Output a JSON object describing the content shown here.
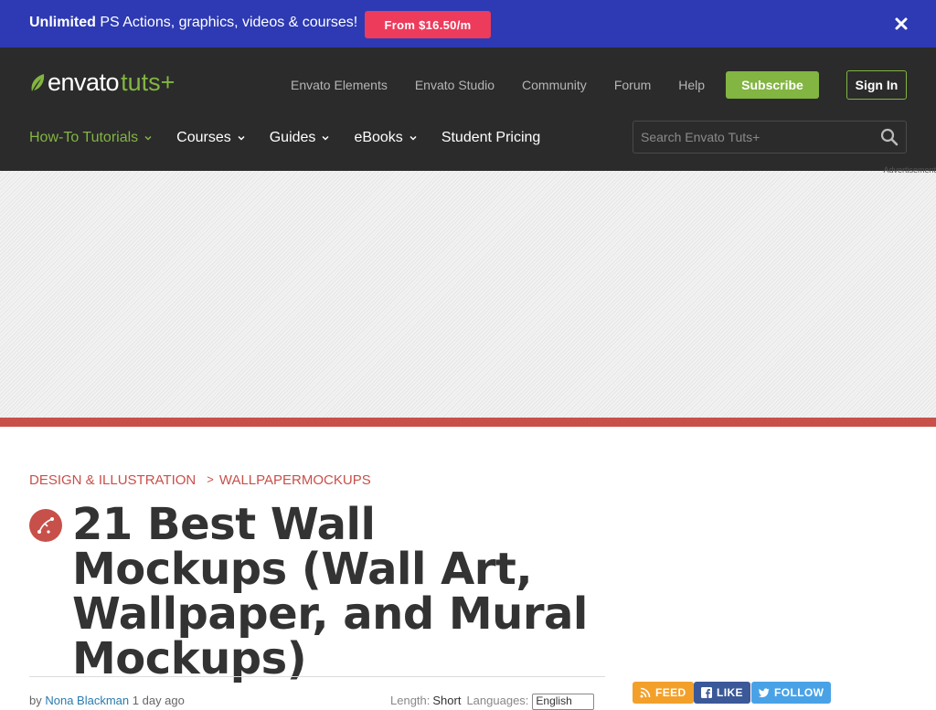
{
  "promo": {
    "text_bold": "Unlimited",
    "text_rest": " PS Actions, graphics, videos & courses!",
    "button": "From $16.50/m",
    "close_icon": "close-icon"
  },
  "header": {
    "logo_envato": "envato",
    "logo_tuts": "tuts+",
    "top_links": [
      "Envato Elements",
      "Envato Studio",
      "Community",
      "Forum",
      "Help"
    ],
    "subscribe": "Subscribe",
    "sign_in": "Sign In",
    "nav": [
      {
        "label": "How-To Tutorials",
        "dropdown": true
      },
      {
        "label": "Courses",
        "dropdown": true
      },
      {
        "label": "Guides",
        "dropdown": true
      },
      {
        "label": "eBooks",
        "dropdown": true
      },
      {
        "label": "Student Pricing",
        "dropdown": false
      }
    ],
    "search_placeholder": "Search Envato Tuts+"
  },
  "ad": {
    "label": "Advertisement"
  },
  "article": {
    "breadcrumb": [
      "DESIGN & ILLUSTRATION",
      "WALLPAPERMOCKUPS"
    ],
    "title": "21 Best Wall Mockups (Wall Art, Wallpaper, and Mural Mockups)",
    "by": "by",
    "author": "Nona Blackman",
    "time": "1 day ago",
    "length_label": "Length:",
    "length_value": "Short",
    "languages_label": "Languages:",
    "language_selected": "English"
  },
  "social": {
    "feed": "FEED",
    "like": "LIKE",
    "follow": "FOLLOW"
  },
  "colors": {
    "promo_bg": "#2d3ab3",
    "promo_button": "#ed3b5c",
    "header_bg": "#2b2b2b",
    "accent_green": "#82b541",
    "accent_red": "#c8504a"
  }
}
